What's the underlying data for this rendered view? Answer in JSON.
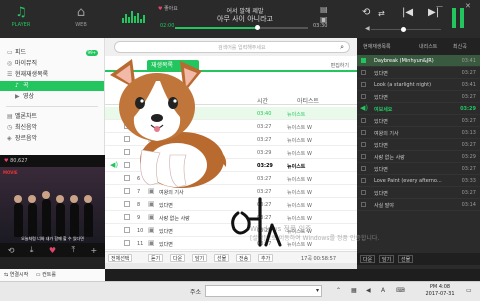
{
  "nav": {
    "player": "PLAYER",
    "web": "WEB"
  },
  "now_playing": {
    "like_label": "좋아요",
    "title": "어서 말해 제발",
    "artist": "아무 사이 아니라고",
    "elapsed": "02:00",
    "total": "03:30",
    "progress": 0.62,
    "volume": 0.45
  },
  "sidebar": {
    "items": [
      {
        "label": "피드",
        "badge": "99+"
      },
      {
        "label": "마이뮤직"
      },
      {
        "label": "현재재생목록"
      },
      {
        "label": "곡"
      },
      {
        "label": "영상"
      },
      {
        "label": "멜론차트"
      },
      {
        "label": "최신음악"
      },
      {
        "label": "장르음악"
      }
    ]
  },
  "video": {
    "likes": "80,627",
    "logo": "MOVIE",
    "caption": "오늘처럼 너와 내가 함께 할 수 있다면"
  },
  "bottom_left": {
    "label1": "연결시작",
    "label2": "컨트롤"
  },
  "main": {
    "search_placeholder": "검색어를 입력해주세요",
    "tab_active": "재생목록",
    "tab_right": "편집하기",
    "columns": {
      "time": "시간",
      "artist": "아티스트"
    },
    "rows": [
      {
        "num": "",
        "title": "",
        "time": "03:40",
        "artist": "뉴이스트",
        "state": "highlight"
      },
      {
        "num": "",
        "title": "",
        "time": "03:27",
        "artist": "뉴이스트 W",
        "state": ""
      },
      {
        "num": "",
        "title": "",
        "time": "03:27",
        "artist": "뉴이스트 W",
        "state": ""
      },
      {
        "num": "",
        "title": "",
        "time": "03:29",
        "artist": "뉴이스트 W",
        "state": ""
      },
      {
        "num": "",
        "title": "여보세요",
        "time": "03:29",
        "artist": "뉴이스트",
        "state": "playing"
      },
      {
        "num": "6",
        "title": "있다면",
        "time": "03:27",
        "artist": "뉴이스트 W",
        "state": ""
      },
      {
        "num": "7",
        "title": "여왕의 기사",
        "time": "03:27",
        "artist": "뉴이스트 W",
        "state": ""
      },
      {
        "num": "8",
        "title": "있다면",
        "time": "03:27",
        "artist": "뉴이스트 W",
        "state": ""
      },
      {
        "num": "9",
        "title": "사랑 없는 사랑",
        "time": "03:27",
        "artist": "뉴이스트 W",
        "state": ""
      },
      {
        "num": "10",
        "title": "있다면",
        "time": "03:27",
        "artist": "뉴이스트 W",
        "state": ""
      },
      {
        "num": "11",
        "title": "있다면",
        "time": "03:27",
        "artist": "뉴이스트 W",
        "state": ""
      }
    ],
    "actions": [
      "전체선택",
      "듣기",
      "다운",
      "담기",
      "선물",
      "전송",
      "추가"
    ],
    "summary": "17곡 00:58:57"
  },
  "watermark": {
    "line1": "Windows 정품 인증",
    "line2": "[설정]으로 이동하여 Windows를 정품 인증합니다."
  },
  "handwriting": "어",
  "playlist": {
    "tabs": [
      "현재재생목록",
      "내리스트",
      "최신곡"
    ],
    "rows": [
      {
        "title": "Daybreak (Minhyun&JR)",
        "dur": "03:41",
        "state": "sel"
      },
      {
        "title": "있다면",
        "dur": "03:27",
        "state": ""
      },
      {
        "title": "Look (a starlight night)",
        "dur": "03:41",
        "state": ""
      },
      {
        "title": "있다면",
        "dur": "03:27",
        "state": ""
      },
      {
        "title": "여보세요",
        "dur": "03:29",
        "state": "cur"
      },
      {
        "title": "있다면",
        "dur": "03:27",
        "state": ""
      },
      {
        "title": "여왕의 기사",
        "dur": "03:13",
        "state": ""
      },
      {
        "title": "있다면",
        "dur": "03:27",
        "state": ""
      },
      {
        "title": "사랑 없는 사랑",
        "dur": "03:29",
        "state": ""
      },
      {
        "title": "있다면",
        "dur": "03:27",
        "state": ""
      },
      {
        "title": "Love Paint (every afterno...",
        "dur": "03:33",
        "state": ""
      },
      {
        "title": "있다면",
        "dur": "03:27",
        "state": ""
      },
      {
        "title": "사실 말야",
        "dur": "03:14",
        "state": ""
      }
    ],
    "bottom": [
      "다운",
      "담기",
      "선물"
    ]
  },
  "taskbar": {
    "address_label": "주소",
    "time": "PM 4:08",
    "date": "2017-07-31"
  },
  "colors": {
    "accent": "#22c55e",
    "heart": "#e0456a",
    "dark": "#2a2a2a"
  },
  "icons": [
    "music-note-icon",
    "home-icon",
    "heart-icon",
    "search-icon",
    "speaker-icon",
    "prev-icon",
    "next-icon",
    "repeat-icon",
    "shuffle-icon",
    "pause-icon",
    "minimize-icon",
    "close-icon"
  ]
}
